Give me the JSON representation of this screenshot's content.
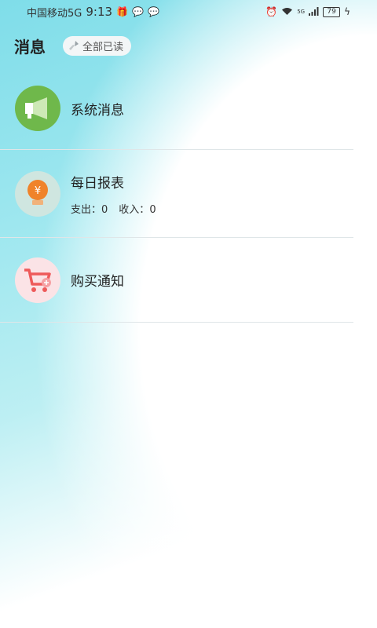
{
  "status_bar": {
    "carrier": "中国移动5G",
    "time": "9:13",
    "battery": "79",
    "network_badge": "5G"
  },
  "header": {
    "title": "消息",
    "read_all_label": "全部已读"
  },
  "messages": [
    {
      "title": "系统消息",
      "icon": "megaphone-icon",
      "color": "#6fb84b"
    },
    {
      "title": "每日报表",
      "icon": "yuan-lightbulb-icon",
      "color": "#f0832a",
      "expense_label": "支出：",
      "expense_value": "0",
      "income_label": "收入：",
      "income_value": "0"
    },
    {
      "title": "购买通知",
      "icon": "cart-icon",
      "color": "#ee5a5a"
    }
  ]
}
